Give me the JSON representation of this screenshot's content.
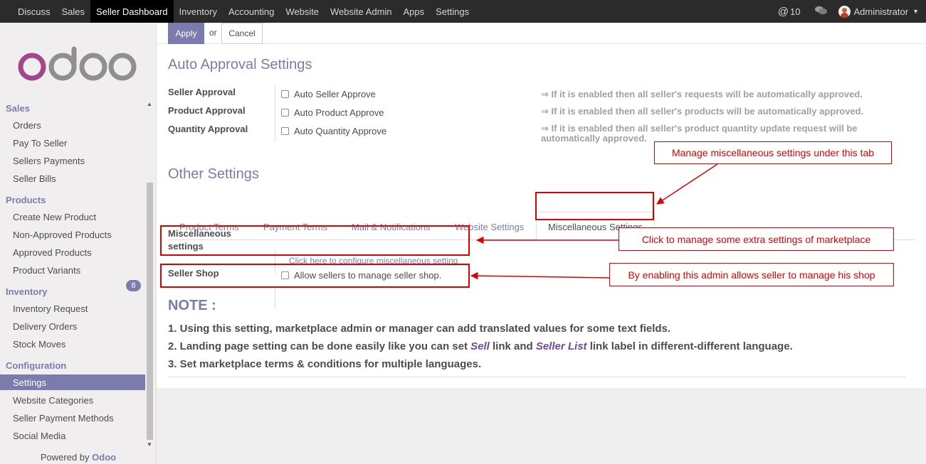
{
  "topbar": {
    "menu": [
      "Discuss",
      "Sales",
      "Seller Dashboard",
      "Inventory",
      "Accounting",
      "Website",
      "Website Admin",
      "Apps",
      "Settings"
    ],
    "active_index": 2,
    "messages_count": "10",
    "user": "Administrator"
  },
  "sidebar": {
    "sections": {
      "sales": "Sales",
      "products": "Products",
      "inventory": "Inventory",
      "configuration": "Configuration"
    },
    "sales_items": [
      "Orders",
      "Pay To Seller",
      "Sellers Payments",
      "Seller Bills"
    ],
    "products_items": [
      "Create New Product",
      "Non-Approved Products",
      "Approved Products",
      "Product Variants"
    ],
    "inventory_items": [
      "Inventory Request",
      "Delivery Orders",
      "Stock Moves"
    ],
    "inventory_request_count": "8",
    "configuration_items": [
      "Settings",
      "Website Categories",
      "Seller Payment Methods",
      "Social Media"
    ],
    "active_item": "Settings",
    "powered_prefix": "Powered by",
    "powered_brand": "Odoo"
  },
  "controls": {
    "apply": "Apply",
    "or": "or",
    "cancel": "Cancel"
  },
  "auto_approval": {
    "title": "Auto Approval Settings",
    "rows": [
      {
        "label": "Seller Approval",
        "option": "Auto Seller Approve",
        "hint": "⇒ If it is enabled then all seller's requests will be automatically approved."
      },
      {
        "label": "Product Approval",
        "option": "Auto Product Approve",
        "hint": "⇒ If it is enabled then all seller's products will be automatically approved."
      },
      {
        "label": "Quantity Approval",
        "option": "Auto Quantity Approve",
        "hint_line1": "⇒ If it is enabled then all seller's product quantity update request will be",
        "hint_line2": "automatically approved."
      }
    ]
  },
  "other_settings": {
    "title": "Other Settings",
    "tabs": [
      "Product Terms",
      "Payment Terms",
      "Mail & Notifications",
      "Website Settings",
      "Miscellaneous Settings"
    ],
    "active_tab": "Miscellaneous Settings",
    "misc_label_line1": "Miscellaneous",
    "misc_label_line2": "settings",
    "misc_link": "Click here to configure miscellaneous setting",
    "shop_label": "Seller Shop",
    "shop_option": "Allow sellers to manage seller shop."
  },
  "note": {
    "title": "NOTE :",
    "line1": "1. Using this setting, marketplace admin or manager can add translated values for some text fields.",
    "line2_a": "2. Landing page setting can be done easily like you can set ",
    "line2_sell": "Sell",
    "line2_b": " link and ",
    "line2_list": "Seller List",
    "line2_c": " link label in different-different language.",
    "line3": "3. Set marketplace terms & conditions for multiple languages."
  },
  "annotations": {
    "tab_callout": "Manage miscellaneous settings under this tab",
    "misc_callout": "Click to manage some extra settings of marketplace",
    "shop_callout": "By enabling this admin allows seller to manage his shop"
  },
  "colors": {
    "accent": "#7c7bad",
    "annotation": "#e00000",
    "topbar": "#2b2b2b"
  }
}
